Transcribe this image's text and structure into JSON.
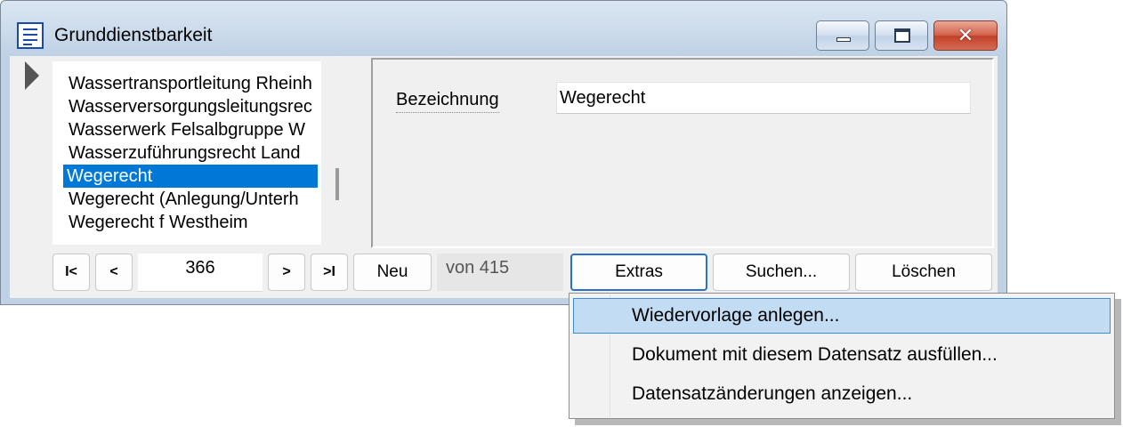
{
  "window": {
    "title": "Grunddienstbarkeit",
    "icon": "form-icon",
    "controls": {
      "minimize": "minimize-icon",
      "maximize": "maximize-icon",
      "close": "close-icon"
    },
    "close_glyph": "✕"
  },
  "list": {
    "items": [
      "Wassertransportleitung Rheinh",
      "Wasserversorgungsleitungsrec",
      "Wasserwerk Felsalbgruppe W",
      "Wasserzuführungsrecht Land",
      "Wegerecht",
      "Wegerecht (Anlegung/Unterh",
      "Wegerecht f Westheim"
    ],
    "selected_index": 4
  },
  "detail": {
    "bezeichnung_label": "Bezeichnung",
    "bezeichnung_value": "Wegerecht"
  },
  "navigation": {
    "first_label": "I<",
    "prev_label": "<",
    "current_record": "366",
    "next_label": ">",
    "last_label": ">I",
    "new_label": "Neu",
    "total_label": "von 415",
    "extras_label": "Extras",
    "search_label": "Suchen...",
    "delete_label": "Löschen"
  },
  "extras_menu": {
    "items": [
      "Wiedervorlage anlegen...",
      "Dokument mit diesem Datensatz ausfüllen...",
      "Datensatzänderungen anzeigen..."
    ],
    "highlighted_index": 0
  },
  "colors": {
    "selection": "#0078d7",
    "menu_highlight": "#c1dcf3",
    "menu_highlight_border": "#3b8ed6",
    "title_bar": "#c9d9ea",
    "close_button": "#c2412a"
  }
}
